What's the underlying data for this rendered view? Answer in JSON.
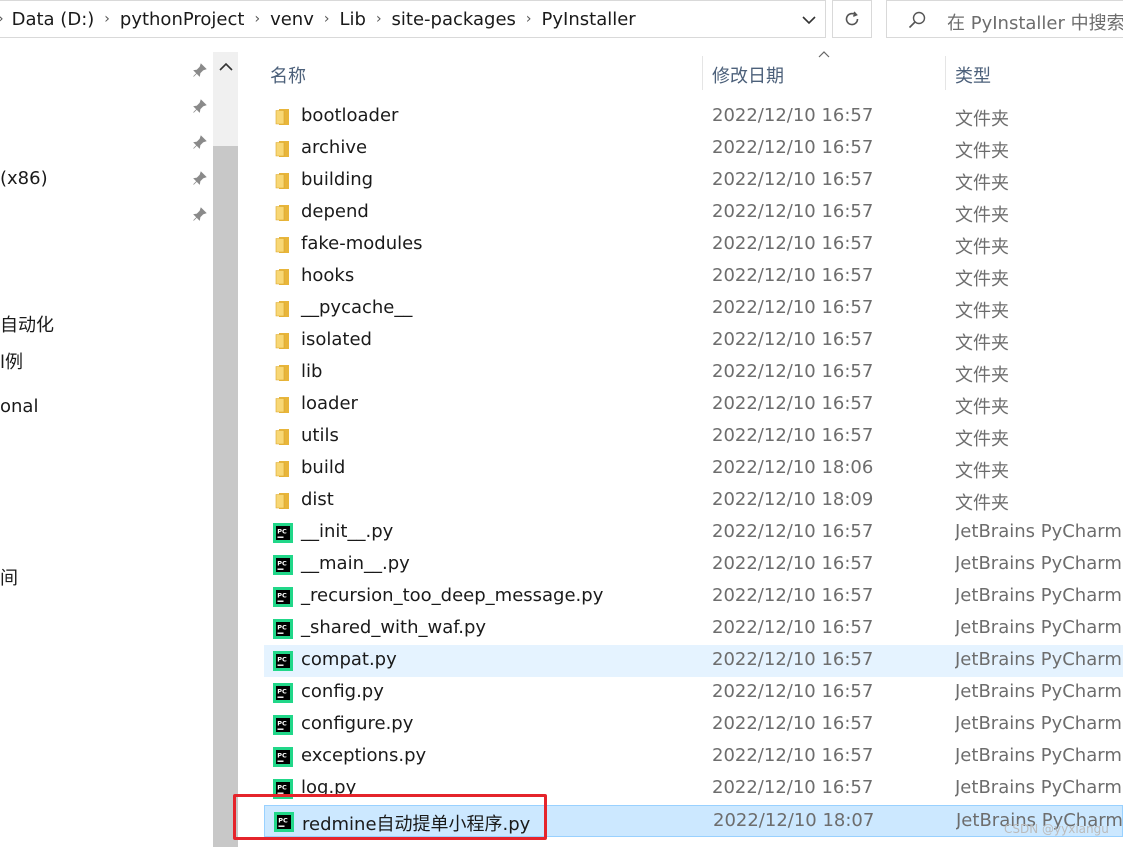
{
  "address_bar": {
    "crumbs": [
      "Data (D:)",
      "pythonProject",
      "venv",
      "Lib",
      "site-packages",
      "PyInstaller"
    ]
  },
  "search": {
    "placeholder": "在 PyInstaller 中搜索"
  },
  "nav": {
    "items": [
      {
        "label": "(x86)"
      },
      {
        "label": "自动化"
      },
      {
        "label": "l例"
      },
      {
        "label": "onal"
      },
      {
        "label": "间"
      }
    ]
  },
  "columns": {
    "name": "名称",
    "date": "修改日期",
    "type": "类型"
  },
  "files": [
    {
      "name": "bootloader",
      "date": "2022/12/10 16:57",
      "type": "文件夹",
      "icon": "folder-icon"
    },
    {
      "name": "archive",
      "date": "2022/12/10 16:57",
      "type": "文件夹",
      "icon": "folder-icon"
    },
    {
      "name": "building",
      "date": "2022/12/10 16:57",
      "type": "文件夹",
      "icon": "folder-icon"
    },
    {
      "name": "depend",
      "date": "2022/12/10 16:57",
      "type": "文件夹",
      "icon": "folder-icon"
    },
    {
      "name": "fake-modules",
      "date": "2022/12/10 16:57",
      "type": "文件夹",
      "icon": "folder-icon"
    },
    {
      "name": "hooks",
      "date": "2022/12/10 16:57",
      "type": "文件夹",
      "icon": "folder-icon"
    },
    {
      "name": "__pycache__",
      "date": "2022/12/10 16:57",
      "type": "文件夹",
      "icon": "folder-icon"
    },
    {
      "name": "isolated",
      "date": "2022/12/10 16:57",
      "type": "文件夹",
      "icon": "folder-icon"
    },
    {
      "name": "lib",
      "date": "2022/12/10 16:57",
      "type": "文件夹",
      "icon": "folder-icon"
    },
    {
      "name": "loader",
      "date": "2022/12/10 16:57",
      "type": "文件夹",
      "icon": "folder-icon"
    },
    {
      "name": "utils",
      "date": "2022/12/10 16:57",
      "type": "文件夹",
      "icon": "folder-icon"
    },
    {
      "name": "build",
      "date": "2022/12/10 18:06",
      "type": "文件夹",
      "icon": "folder-icon"
    },
    {
      "name": "dist",
      "date": "2022/12/10 18:09",
      "type": "文件夹",
      "icon": "folder-icon"
    },
    {
      "name": "__init__.py",
      "date": "2022/12/10 16:57",
      "type": "JetBrains PyCharm ...",
      "icon": "pycharm-icon"
    },
    {
      "name": "__main__.py",
      "date": "2022/12/10 16:57",
      "type": "JetBrains PyCharm ...",
      "icon": "pycharm-icon"
    },
    {
      "name": "_recursion_too_deep_message.py",
      "date": "2022/12/10 16:57",
      "type": "JetBrains PyCharm ...",
      "icon": "pycharm-icon"
    },
    {
      "name": "_shared_with_waf.py",
      "date": "2022/12/10 16:57",
      "type": "JetBrains PyCharm ...",
      "icon": "pycharm-icon"
    },
    {
      "name": "compat.py",
      "date": "2022/12/10 16:57",
      "type": "JetBrains PyCharm ...",
      "icon": "pycharm-icon",
      "state": "hover"
    },
    {
      "name": "config.py",
      "date": "2022/12/10 16:57",
      "type": "JetBrains PyCharm ...",
      "icon": "pycharm-icon"
    },
    {
      "name": "configure.py",
      "date": "2022/12/10 16:57",
      "type": "JetBrains PyCharm ...",
      "icon": "pycharm-icon"
    },
    {
      "name": "exceptions.py",
      "date": "2022/12/10 16:57",
      "type": "JetBrains PyCharm ...",
      "icon": "pycharm-icon"
    },
    {
      "name": "log.py",
      "date": "2022/12/10 16:57",
      "type": "JetBrains PyCharm ...",
      "icon": "pycharm-icon"
    },
    {
      "name": "redmine自动提单小程序.py",
      "date": "2022/12/10 18:07",
      "type": "JetBrains PyCharm ...",
      "icon": "pycharm-icon",
      "state": "selected"
    }
  ],
  "watermark": "CSDN @yyxiangu",
  "colors": {
    "highlight": "#e5242b",
    "selected_bg": "#cce8ff",
    "hover_bg": "#e5f3ff",
    "header_text": "#4c607a"
  }
}
